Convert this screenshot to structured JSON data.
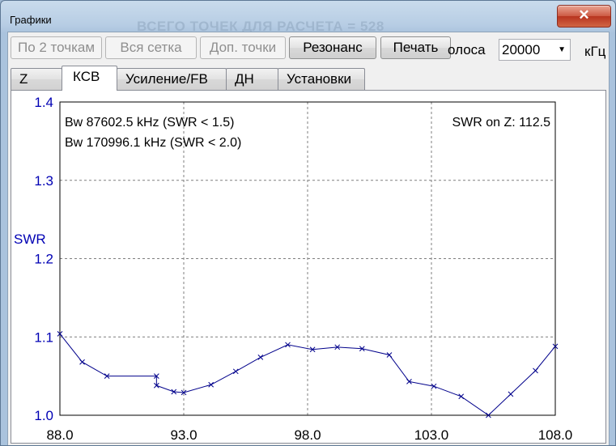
{
  "window": {
    "title": "Графики",
    "background_title": "ВСЕГО ТОЧЕК ДЛЯ РАСЧЕТА = 528",
    "close_label": "✕"
  },
  "toolbar": {
    "two_points": "По 2 точкам",
    "full_grid": "Вся сетка",
    "extra_points": "Доп. точки",
    "resonance": "Резонанс",
    "print": "Печать",
    "bandwidth_label": "олоса",
    "bandwidth_value": "20000",
    "units": "кГц"
  },
  "tabs": [
    {
      "label": "Z",
      "active": false
    },
    {
      "label": "КСВ",
      "active": true
    },
    {
      "label": "Усиление/FB",
      "active": false
    },
    {
      "label": "ДН",
      "active": false
    },
    {
      "label": "Установки",
      "active": false
    }
  ],
  "chart_data": {
    "type": "line",
    "ylabel": "SWR",
    "xlabel": "",
    "ylim": [
      1.0,
      1.4
    ],
    "xlim": [
      88.0,
      108.0
    ],
    "yticks": [
      "1.0",
      "1.1",
      "1.2",
      "1.3",
      "1.4"
    ],
    "xticks": [
      "88.0",
      "93.0",
      "98.0",
      "103.0",
      "108.0"
    ],
    "grid": true,
    "annotations": {
      "bw1": "Bw 87602.5 kHz (SWR < 1.5)",
      "bw2": "Bw 170996.1 kHz (SWR < 2.0)",
      "swr_on_z": "SWR on Z: 112.5"
    },
    "series": [
      {
        "color": "#00008b",
        "marker": "x",
        "x": [
          88.0,
          88.9,
          89.9,
          91.9,
          91.9,
          92.6,
          93.0,
          94.1,
          95.1,
          96.1,
          97.2,
          98.2,
          99.2,
          100.2,
          101.3,
          102.1,
          103.1,
          104.2,
          105.3,
          106.2,
          107.2,
          108.0
        ],
        "y": [
          1.104,
          1.068,
          1.05,
          1.05,
          1.038,
          1.03,
          1.029,
          1.039,
          1.056,
          1.074,
          1.09,
          1.084,
          1.087,
          1.085,
          1.077,
          1.043,
          1.037,
          1.024,
          1.0,
          1.027,
          1.057,
          1.088
        ]
      }
    ]
  }
}
